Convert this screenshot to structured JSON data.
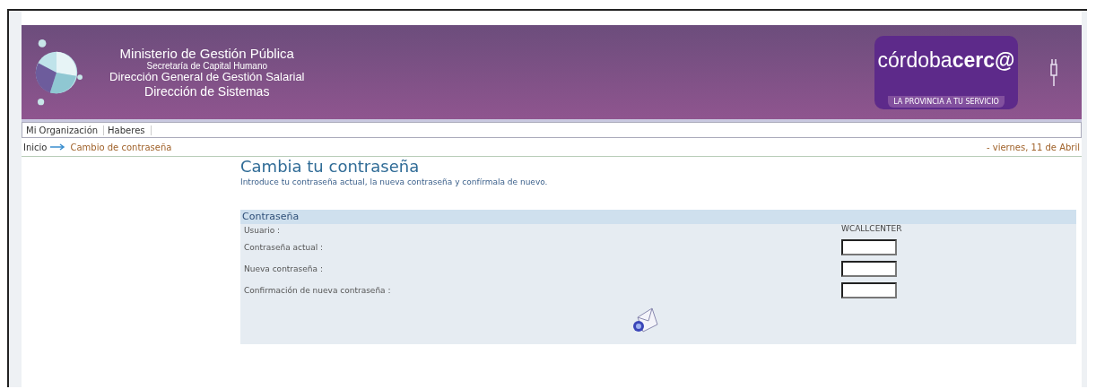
{
  "header": {
    "titles": [
      "Ministerio de Gestión Pública",
      "Secretaría de Capital Humano",
      "Dirección General de Gestión Salarial",
      "Dirección de Sistemas"
    ],
    "brand": "córdoba**cerc@**",
    "tagline": "LA PROVINCIA A TU SERVICIO"
  },
  "nav": [
    {
      "label": "Mi Organización"
    },
    {
      "label": "Haberes"
    }
  ],
  "breadcrumb": {
    "home": "Inicio",
    "current": "Cambio de contraseña",
    "date": "- viernes, 11 de Abril"
  },
  "page": {
    "title": "Cambia tu contraseña",
    "subtitle": "Introduce tu contraseña actual, la nueva contraseña y confírmala de nuevo."
  },
  "form": {
    "section": "Contraseña",
    "fields": [
      {
        "kind": "text",
        "label": "Usuario :",
        "value": "WCALLCENTER"
      },
      {
        "kind": "password",
        "label": "Contraseña actual :"
      },
      {
        "kind": "password",
        "label": "Nueva contraseña :"
      },
      {
        "kind": "password",
        "label": "Confirmación de nueva contraseña :"
      }
    ]
  }
}
